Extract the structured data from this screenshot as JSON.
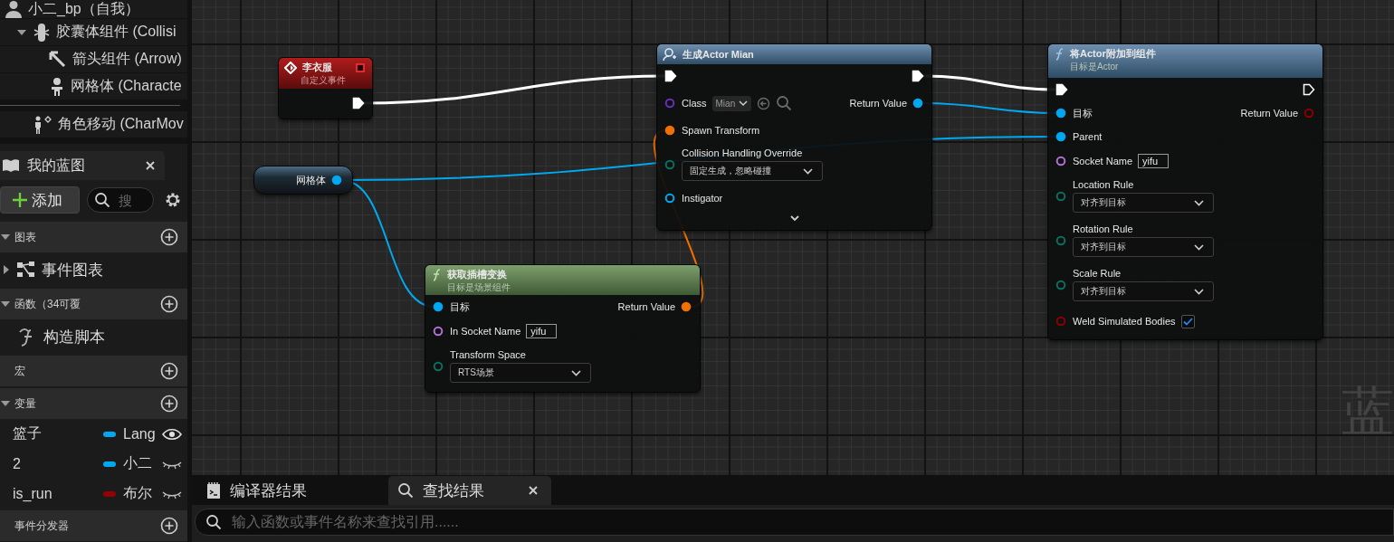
{
  "components": {
    "root": "小二_bp（自我）",
    "scene": [
      {
        "label": "胶囊体组件 (Collisi",
        "kind": "capsule",
        "expanded": true,
        "children": [
          {
            "label": "箭头组件 (Arrow)",
            "kind": "arrow"
          },
          {
            "label": "网格体 (Characte",
            "kind": "mesh"
          }
        ]
      }
    ],
    "other": [
      {
        "label": "角色移动 (CharMov",
        "kind": "movement"
      }
    ]
  },
  "my_blueprint": {
    "title": "我的蓝图",
    "add_button": "添加",
    "search": {
      "placeholder": "搜"
    },
    "sections": [
      {
        "title": "图表",
        "expanded": true,
        "items": [
          {
            "label": "事件图表",
            "kind": "graph",
            "expanded": false
          }
        ]
      },
      {
        "title": "函数（34可覆",
        "expanded": true,
        "items": [
          {
            "label": "构造脚本",
            "kind": "function"
          }
        ]
      },
      {
        "title": "宏"
      },
      {
        "title": "变量",
        "expanded": true,
        "variables": [
          {
            "name": "篮子",
            "type": "Lang",
            "color": "#00a8f0",
            "exposed": true
          },
          {
            "name": "2",
            "type": "小二",
            "color": "#00a8f0",
            "exposed": false
          },
          {
            "name": "is_run",
            "type": "布尔",
            "color": "#950000",
            "exposed": false
          }
        ]
      },
      {
        "title": "事件分发器"
      }
    ]
  },
  "graph": {
    "type_label": "蓝",
    "nodes": [
      {
        "kind": "event",
        "title": "李衣服",
        "subtitle": "自定义事件",
        "rows": [
          {
            "right": {
              "kind": "exec",
              "connected": true
            }
          }
        ]
      },
      {
        "kind": "variable",
        "rows": [
          {
            "right": {
              "kind": "data",
              "label": "网格体",
              "color": "#00a8f0",
              "connected": true
            }
          }
        ]
      },
      {
        "kind": "spawn",
        "title": "生成Actor Mian",
        "advanced": true,
        "rows": [
          {
            "left": {
              "kind": "exec",
              "connected": true
            },
            "right": {
              "kind": "exec",
              "connected": true
            }
          },
          {
            "left": {
              "kind": "class",
              "label": "Class",
              "value": "Mian",
              "color": "#6a2fc0",
              "connected": false
            },
            "right": {
              "kind": "data",
              "label": "Return Value",
              "color": "#00a8f0",
              "connected": true
            }
          },
          {
            "left": {
              "kind": "data",
              "label": "Spawn Transform",
              "color": "#f07000",
              "connected": true
            }
          },
          {
            "left": {
              "kind": "enum",
              "label": "Collision Handling Override",
              "value": "固定生成，忽略碰撞",
              "color": "#0a6f60",
              "connected": false
            }
          },
          {
            "left": {
              "kind": "data",
              "label": "Instigator",
              "color": "#00a8f0",
              "connected": false
            }
          }
        ]
      },
      {
        "kind": "function",
        "title": "将Actor附加到组件",
        "subtitle": "目标是Actor",
        "rows": [
          {
            "left": {
              "kind": "exec",
              "connected": true
            },
            "right": {
              "kind": "exec",
              "connected": false
            }
          },
          {
            "left": {
              "kind": "data",
              "label": "目标",
              "color": "#00a8f0",
              "connected": true
            },
            "right": {
              "kind": "data",
              "label": "Return Value",
              "color": "#8b0000",
              "connected": false
            }
          },
          {
            "left": {
              "kind": "data",
              "label": "Parent",
              "color": "#00a8f0",
              "connected": true
            }
          },
          {
            "left": {
              "kind": "name",
              "label": "Socket Name",
              "value": "yifu",
              "color": "#b070d8",
              "connected": false
            }
          },
          {
            "left": {
              "kind": "enum",
              "label": "Location Rule",
              "value": "对齐到目标",
              "color": "#0a6f60",
              "connected": false
            }
          },
          {
            "left": {
              "kind": "enum",
              "label": "Rotation Rule",
              "value": "对齐到目标",
              "color": "#0a6f60",
              "connected": false
            }
          },
          {
            "left": {
              "kind": "enum",
              "label": "Scale Rule",
              "value": "对齐到目标",
              "color": "#0a6f60",
              "connected": false
            }
          },
          {
            "left": {
              "kind": "bool",
              "label": "Weld Simulated Bodies",
              "checked": true,
              "color": "#8b0000",
              "connected": false
            }
          }
        ]
      },
      {
        "kind": "pure_function",
        "title": "获取插槽变换",
        "subtitle": "目标是场景组件",
        "rows": [
          {
            "left": {
              "kind": "data",
              "label": "目标",
              "color": "#00a8f0",
              "connected": true
            },
            "right": {
              "kind": "data",
              "label": "Return Value",
              "color": "#f07000",
              "connected": true
            }
          },
          {
            "left": {
              "kind": "name",
              "label": "In Socket Name",
              "value": "yifu",
              "color": "#b070d8",
              "connected": false
            }
          },
          {
            "left": {
              "kind": "enum",
              "label": "Transform Space",
              "value": "RTS场景",
              "color": "#0a6f60",
              "connected": false
            }
          }
        ]
      }
    ]
  },
  "bottom_panel": {
    "tabs": [
      {
        "label": "编译器结果",
        "kind": "log",
        "selected": false
      },
      {
        "label": "查找结果",
        "kind": "search",
        "selected": true,
        "closable": true
      }
    ],
    "search": {
      "placeholder": "输入函数或事件名称来查找引用......"
    }
  }
}
